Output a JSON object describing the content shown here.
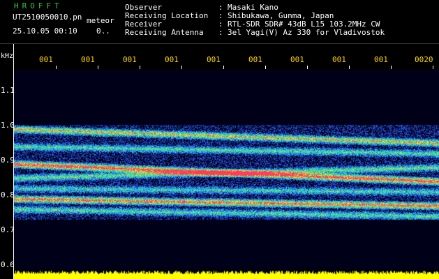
{
  "header": {
    "app_title": "HROFFT",
    "file_name": "UT2510050010.pn",
    "file_tag": "meteor",
    "datetime": "25.10.05 00:10",
    "count": "0.."
  },
  "info": [
    {
      "label": "Observer",
      "value": "Masaki Kano"
    },
    {
      "label": "Receiving Location",
      "value": "Shibukawa, Gunma, Japan"
    },
    {
      "label": "Receiver",
      "value": "RTL-SDR SDR# 43dB L15 103.2MHz CW"
    },
    {
      "label": "Receiving Antenna",
      "value": "3el Yagi(V) Az 330 for Vladivostok"
    }
  ],
  "axis": {
    "unit": "kHz",
    "y_ticks": [
      "1.1",
      "1.0",
      "0.9",
      "0.8",
      "0.7",
      "0.6"
    ],
    "x_ticks": [
      "001",
      "001",
      "001",
      "001",
      "001",
      "001",
      "001",
      "001",
      "001",
      "0020"
    ]
  },
  "colors": {
    "background": "#000018",
    "title": "#2ecc40",
    "time_labels": "#ffd700",
    "noise": "#ffff00",
    "echo_hot": "#ff3050"
  },
  "spectrogram": {
    "bands_khz": [
      {
        "start": 1.01,
        "end": 0.97,
        "strength": 0.75
      },
      {
        "start": 0.96,
        "end": 0.94,
        "strength": 0.5
      },
      {
        "start": 0.91,
        "end": 0.86,
        "strength": 1.0
      },
      {
        "start": 0.87,
        "end": 0.9,
        "strength": 0.55
      },
      {
        "start": 0.84,
        "end": 0.83,
        "strength": 0.45
      },
      {
        "start": 0.81,
        "end": 0.79,
        "strength": 0.9
      },
      {
        "start": 0.78,
        "end": 0.76,
        "strength": 0.5
      }
    ],
    "noise_level": 0.6
  }
}
